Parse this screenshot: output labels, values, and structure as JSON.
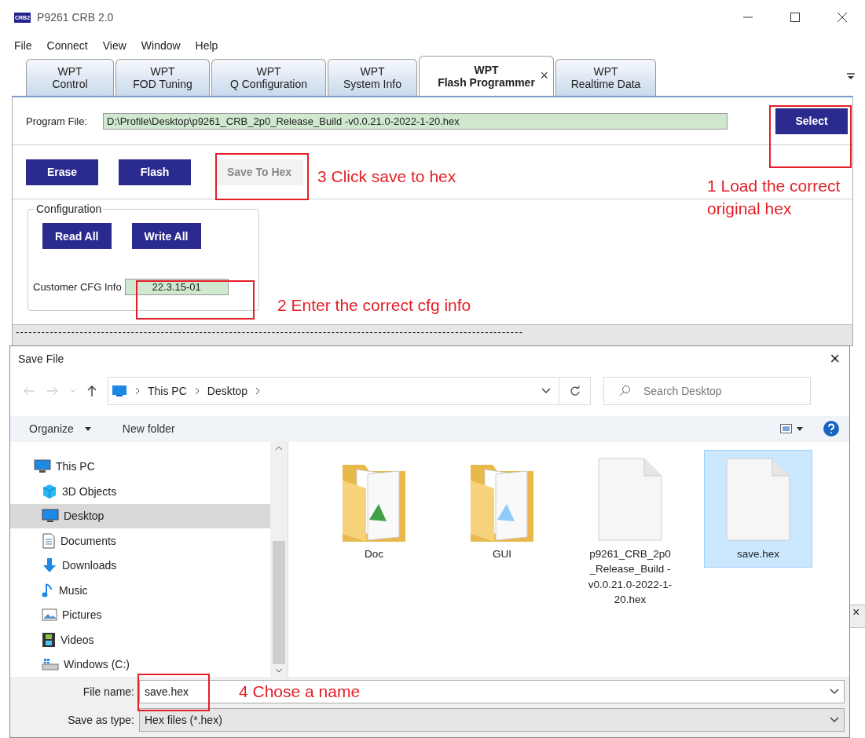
{
  "window": {
    "title": "P9261 CRB 2.0",
    "logo": "CRB2"
  },
  "menu": [
    "File",
    "Connect",
    "View",
    "Window",
    "Help"
  ],
  "tabs": [
    {
      "line1": "WPT",
      "line2": "Control",
      "selected": false
    },
    {
      "line1": "WPT",
      "line2": "FOD Tuning",
      "selected": false
    },
    {
      "line1": "WPT",
      "line2": "Q Configuration",
      "selected": false
    },
    {
      "line1": "WPT",
      "line2": "System Info",
      "selected": false
    },
    {
      "line1": "WPT",
      "line2": "Flash Programmer",
      "selected": true,
      "close": "×"
    },
    {
      "line1": "WPT",
      "line2": "Realtime Data",
      "selected": false
    }
  ],
  "program_file": {
    "label": "Program File:",
    "value": "D:\\Profile\\Desktop\\p9261_CRB_2p0_Release_Build -v0.0.21.0-2022-1-20.hex",
    "button": "Select"
  },
  "actions": [
    {
      "label": "Erase",
      "disabled": false
    },
    {
      "label": "Flash",
      "disabled": false
    },
    {
      "label": "Save To Hex",
      "disabled": true
    }
  ],
  "configuration": {
    "title": "Configuration",
    "buttons": [
      "Read All",
      "Write All"
    ],
    "cfg_label": "Customer CFG Info",
    "cfg_value": "22.3.15-01"
  },
  "log_line": "-----------------------------------------------------------------------------------------------------------------------",
  "dialog": {
    "title": "Save File",
    "close": "×",
    "path": [
      "This PC",
      "Desktop"
    ],
    "search_placeholder": "Search Desktop",
    "toolbar": [
      "Organize",
      "New folder"
    ],
    "nav": [
      {
        "label": "This PC",
        "kind": "pc",
        "selected": false,
        "children": [
          {
            "label": "3D Objects",
            "kind": "cube",
            "selected": false
          },
          {
            "label": "Desktop",
            "kind": "desktop",
            "selected": true
          },
          {
            "label": "Documents",
            "kind": "documents",
            "selected": false
          },
          {
            "label": "Downloads",
            "kind": "downloads",
            "selected": false
          },
          {
            "label": "Music",
            "kind": "music",
            "selected": false
          },
          {
            "label": "Pictures",
            "kind": "pictures",
            "selected": false
          },
          {
            "label": "Videos",
            "kind": "videos",
            "selected": false
          },
          {
            "label": "Windows (C:)",
            "kind": "drive",
            "selected": false
          }
        ]
      }
    ],
    "files": [
      {
        "name": "Doc",
        "kind": "folder",
        "selected": false
      },
      {
        "name": "GUI",
        "kind": "folder",
        "selected": false
      },
      {
        "name": "p9261_CRB_2p0_Release_Build -v0.0.21.0-2022-1-20.hex",
        "kind": "file",
        "selected": false
      },
      {
        "name": "save.hex",
        "kind": "file",
        "selected": true
      }
    ],
    "file_name": {
      "label": "File name:",
      "value": "save.hex"
    },
    "save_as_type": {
      "label": "Save as type:",
      "value": "Hex files (*.hex)"
    }
  },
  "behind_close": "×",
  "annotations": [
    {
      "text": "1 Load the correct original hex"
    },
    {
      "text": "3 Click save to hex"
    },
    {
      "text": "2 Enter the correct cfg info"
    },
    {
      "text": "4 Chose a name"
    }
  ]
}
